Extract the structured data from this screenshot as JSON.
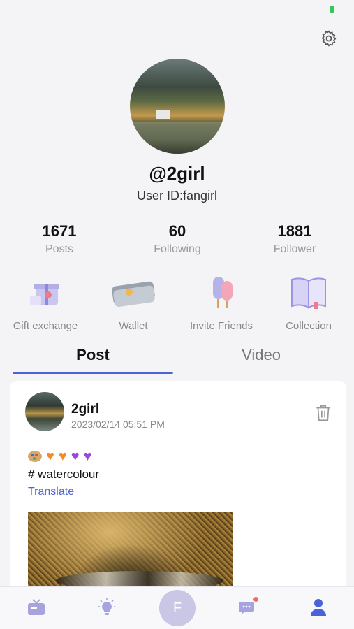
{
  "profile": {
    "username": "@2girl",
    "user_id": "User ID:fangirl"
  },
  "stats": [
    {
      "value": "1671",
      "label": "Posts"
    },
    {
      "value": "60",
      "label": "Following"
    },
    {
      "value": "1881",
      "label": "Follower"
    }
  ],
  "actions": [
    {
      "label": "Gift exchange",
      "icon": "gift-icon"
    },
    {
      "label": "Wallet",
      "icon": "wallet-icon"
    },
    {
      "label": "Invite Friends",
      "icon": "ice-cream-icon"
    },
    {
      "label": "Collection",
      "icon": "book-icon"
    }
  ],
  "tabs": [
    {
      "label": "Post",
      "active": true
    },
    {
      "label": "Video",
      "active": false
    }
  ],
  "post": {
    "author": "2girl",
    "timestamp": "2023/02/14 05:51 PM",
    "hashtag": "# watercolour",
    "translate_label": "Translate",
    "emojis": [
      "palette",
      "orange-heart",
      "orange-heart",
      "purple-heart",
      "purple-heart"
    ]
  },
  "bottom_nav": {
    "center_label": "F",
    "items": [
      "tv-icon",
      "lightbulb-icon",
      "compose-button",
      "chat-icon",
      "profile-icon"
    ]
  },
  "colors": {
    "accent": "#4b63d9",
    "battery": "#34c759",
    "notification": "#f06a6a"
  }
}
